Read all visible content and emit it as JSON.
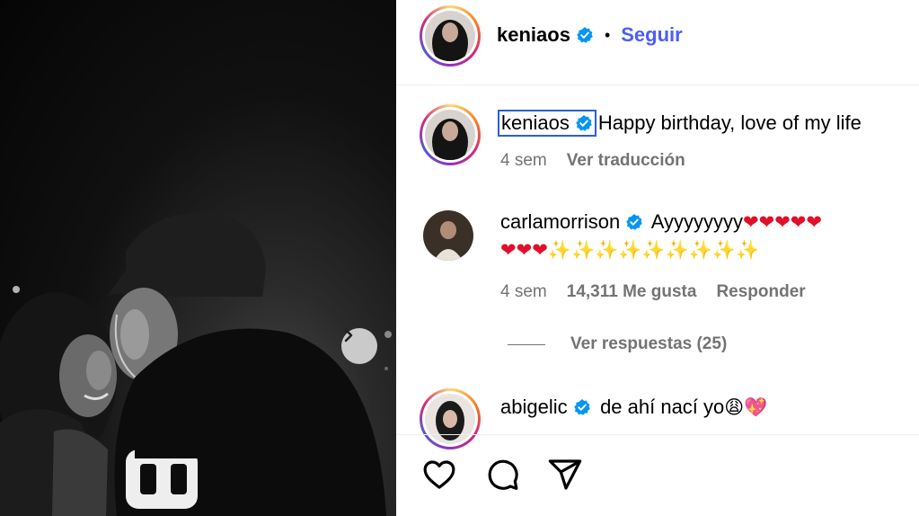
{
  "header": {
    "username": "keniaos",
    "follow_label": "Seguir"
  },
  "caption": {
    "username": "keniaos",
    "text": "Happy birthday, love of my life",
    "time": "4 sem",
    "translate_label": "Ver traducción"
  },
  "comments": [
    {
      "username": "carlamorrison",
      "text": "Ayyyyyyyy",
      "hearts_line1": "❤❤❤❤❤",
      "hearts_line2": "❤❤❤",
      "sparkles": "✨✨✨✨✨✨✨✨✨",
      "time": "4 sem",
      "likes": "14,311 Me gusta",
      "reply_label": "Responder",
      "view_replies": "Ver respuestas (25)"
    },
    {
      "username": "abigelic",
      "text": "de ahí nací yo",
      "emojis": "😩💖"
    }
  ],
  "icons": [
    "verified-badge-icon",
    "chevron-right-icon",
    "heart-icon",
    "comment-icon",
    "share-icon"
  ],
  "colors": {
    "follow": "#4a5df9",
    "verified": "#0095f6",
    "meta": "#737373"
  }
}
